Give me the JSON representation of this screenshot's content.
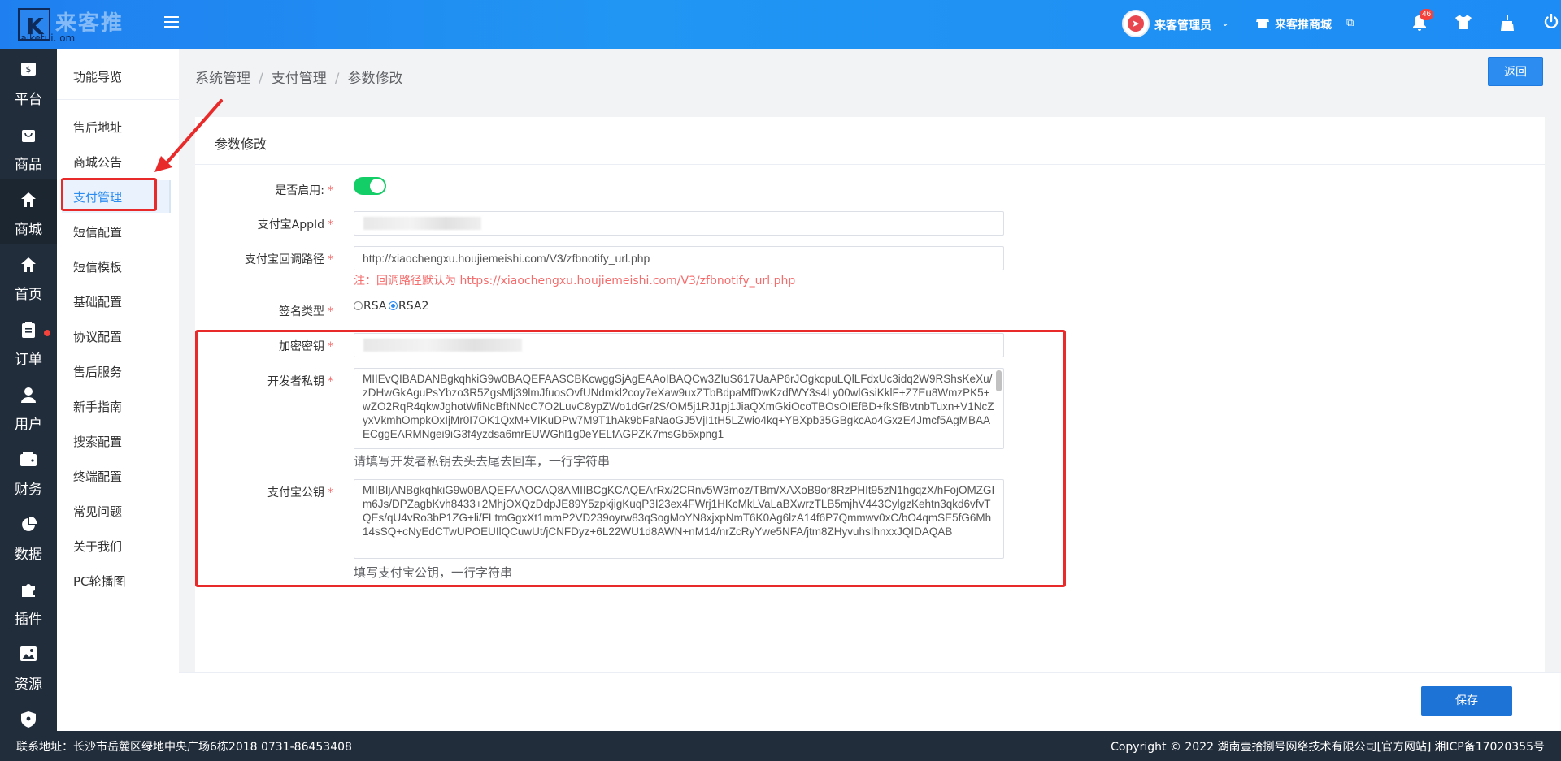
{
  "colors": {
    "topbar": "#2196f3",
    "sidebar": "#222d3b",
    "accent": "#2d8cf0",
    "required": "#f56c6c",
    "switch_on": "#13ce66",
    "annotation": "#e82a2a"
  },
  "header": {
    "logo_title": "来客推",
    "logo_sub": "laiketui. om",
    "user_name": "来客管理员",
    "shop_name": "来客推商城",
    "notification_count": "46",
    "icons": [
      "menu-toggle-icon",
      "shop-icon",
      "external-link-icon",
      "bell-icon",
      "shirt-icon",
      "broom-icon",
      "power-icon"
    ]
  },
  "leftbar": {
    "items": [
      {
        "label": "平台",
        "icon": "dollar-icon"
      },
      {
        "label": "商品",
        "icon": "bag-icon"
      },
      {
        "label": "商城",
        "icon": "store-icon",
        "active": true
      },
      {
        "label": "首页",
        "icon": "home-icon"
      },
      {
        "label": "订单",
        "icon": "clipboard-icon",
        "dot": true
      },
      {
        "label": "用户",
        "icon": "user-icon"
      },
      {
        "label": "财务",
        "icon": "wallet-icon"
      },
      {
        "label": "数据",
        "icon": "pie-chart-icon"
      },
      {
        "label": "插件",
        "icon": "puzzle-icon"
      },
      {
        "label": "资源",
        "icon": "image-icon"
      },
      {
        "label": "",
        "icon": "shield-icon"
      }
    ]
  },
  "submenu": {
    "title": "功能导览",
    "items": [
      "售后地址",
      "商城公告",
      "支付管理",
      "短信配置",
      "短信模板",
      "基础配置",
      "协议配置",
      "售后服务",
      "新手指南",
      "搜索配置",
      "终端配置",
      "常见问题",
      "关于我们",
      "PC轮播图"
    ],
    "active_index": 2
  },
  "breadcrumb": {
    "items": [
      "系统管理",
      "支付管理",
      "参数修改"
    ],
    "separator": "/"
  },
  "back_button": "返回",
  "form": {
    "title": "参数修改",
    "enabled_label": "是否启用:",
    "enabled_value": true,
    "appid_label": "支付宝AppId",
    "appid_value": "",
    "callback_label": "支付宝回调路径",
    "callback_value": "http://xiaochengxu.houjiemeishi.com/V3/zfbnotify_url.php",
    "callback_hint": "注：回调路径默认为 https://xiaochengxu.houjiemeishi.com/V3/zfbnotify_url.php",
    "sign_label": "签名类型",
    "sign_options": [
      "RSA",
      "RSA2"
    ],
    "sign_selected": "RSA2",
    "key_label": "加密密钥",
    "key_value": "",
    "private_key_label": "开发者私钥",
    "private_key_value": "MIIEvQIBADANBgkqhkiG9w0BAQEFAASCBKcwggSjAgEAAoIBAQCw3ZIuS617UaAP6rJOgkcpuLQlLFdxUc3idq2W9RShsKeXu/zDHwGkAguPsYbzo3R5ZgsMlj39lmJfuosOvfUNdmkl2coy7eXaw9uxZTbBdpaMfDwKzdfWY3s4Ly00wlGsiKklF+Z7Eu8WmzPK5+wZO2RqR4qkwJghotWfiNcBftNNcC7O2LuvC8ypZWo1dGr/2S/OM5j1RJ1pj1JiaQXmGkiOcoTBOsOIEfBD+fkSfBvtnbTuxn+V1NcZyxVkmhOmpkOxIjMr0I7OK1QxM+VIKuDPw7M9T1hAk9bFaNaoGJ5VjI1tH5LZwio4kq+YBXpb35GBgkcAo4GxzE4Jmcf5AgMBAAECggEARMNgei9iG3f4yzdsa6mrEUWGhl1g0eYELfAGPZK7msGb5xpng1",
    "private_key_hint": "请填写开发者私钥去头去尾去回车，一行字符串",
    "public_key_label": "支付宝公钥",
    "public_key_value": "MIIBIjANBgkqhkiG9w0BAQEFAAOCAQ8AMIIBCgKCAQEArRx/2CRnv5W3moz/TBm/XAXoB9or8RzPHIt95zN1hgqzX/hFojOMZGIm6Js/DPZagbKvh8433+2MhjOXQzDdpJE89Y5zpkjigKuqP3I23ex4FWrj1HKcMkLVaLaBXwrzTLB5mjhV443CylgzKehtn3qkd6vfvTQEs/qU4vRo3bP1ZG+li/FLtmGgxXt1mmP2VD239oyrw83qSogMoYN8xjxpNmT6K0Ag6lzA14f6P7Qmmwv0xC/bO4qmSE5fG6Mh14sSQ+cNyEdCTwUPOEUIlQCuwUt/jCNFDyz+6L22WU1d8AWN+nM14/nrZcRyYwe5NFA/jtm8ZHyvuhsIhnxxJQIDAQAB",
    "public_key_hint": "填写支付宝公钥，一行字符串"
  },
  "save_button": "保存",
  "footer": {
    "contact": "联系地址：长沙市岳麓区绿地中央广场6栋2018 0731-86453408",
    "copyright": "Copyright © 2022 湖南壹拾捌号网络技术有限公司[官方网站]",
    "icp": "湘ICP备17020355号"
  }
}
